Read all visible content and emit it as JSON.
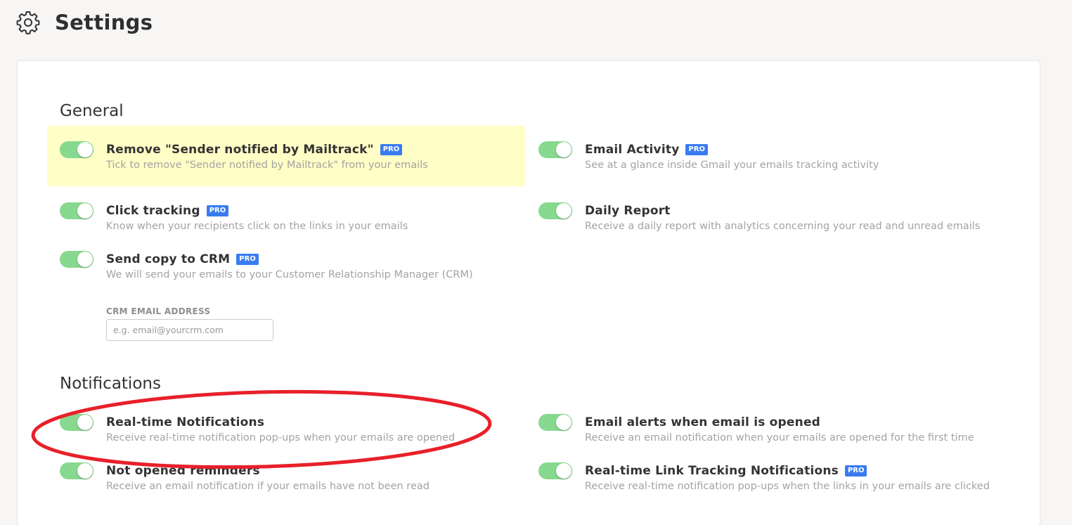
{
  "header": {
    "title": "Settings",
    "icon": "gear-icon"
  },
  "sections": {
    "general": {
      "title": "General",
      "items": {
        "remove_sender": {
          "label": "Remove \"Sender notified by Mailtrack\"",
          "pro": "PRO",
          "description": "Tick to remove \"Sender notified by Mailtrack\" from your emails",
          "enabled": true
        },
        "email_activity": {
          "label": "Email Activity",
          "pro": "PRO",
          "description": "See at a glance inside Gmail your emails tracking activity",
          "enabled": true
        },
        "click_tracking": {
          "label": "Click tracking",
          "pro": "PRO",
          "description": "Know when your recipients click on the links in your emails",
          "enabled": true
        },
        "daily_report": {
          "label": "Daily Report",
          "description": "Receive a daily report with analytics concerning your read and unread emails",
          "enabled": true
        },
        "send_copy_crm": {
          "label": "Send copy to CRM",
          "pro": "PRO",
          "description": "We will send your emails to your Customer Relationship Manager (CRM)",
          "enabled": true
        }
      },
      "crm": {
        "label": "CRM EMAIL ADDRESS",
        "placeholder": "e.g. email@yourcrm.com",
        "value": ""
      }
    },
    "notifications": {
      "title": "Notifications",
      "items": {
        "realtime": {
          "label": "Real-time Notifications",
          "description": "Receive real-time notification pop-ups when your emails are opened",
          "enabled": true
        },
        "email_alerts": {
          "label": "Email alerts when email is opened",
          "description": "Receive an email notification when your emails are opened for the first time",
          "enabled": true
        },
        "not_opened": {
          "label": "Not opened reminders",
          "description": "Receive an email notification if your emails have not been read",
          "enabled": true
        },
        "realtime_link": {
          "label": "Real-time Link Tracking Notifications",
          "pro": "PRO",
          "description": "Receive real-time notification pop-ups when the links in your emails are clicked",
          "enabled": true
        }
      }
    }
  },
  "colors": {
    "toggle_on": "#86d98f",
    "pro_badge": "#3a7cf0",
    "highlight": "#fefec6",
    "annotation": "#e8202a"
  }
}
